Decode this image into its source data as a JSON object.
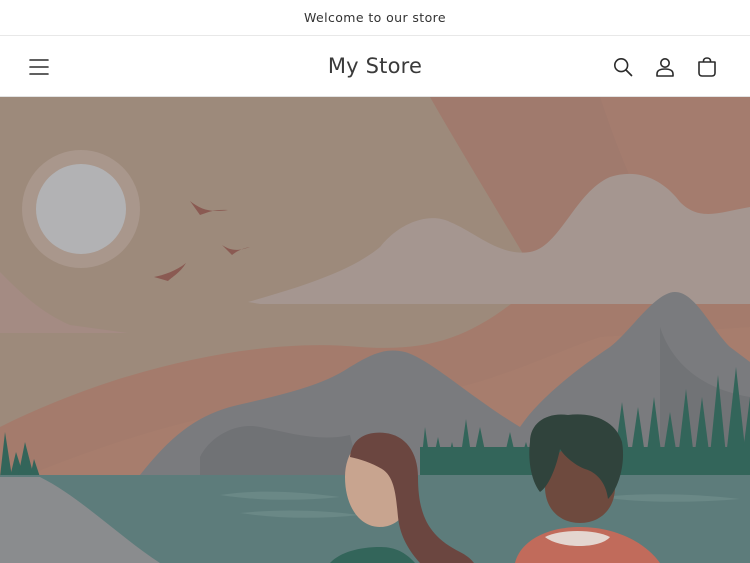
{
  "announcement": {
    "text": "Welcome to our store"
  },
  "header": {
    "store_name": "My Store",
    "icons": {
      "menu": "hamburger-menu-icon",
      "search": "search-icon",
      "account": "account-icon",
      "cart": "cart-icon"
    }
  },
  "hero": {
    "image": "landscape-illustration",
    "colors": {
      "sky": "#9e8878",
      "sun": "#b2b2b4",
      "cloud": "#a4968f",
      "mountain": "#787a7c",
      "trees": "#33655a",
      "water": "#5b7c7c"
    }
  }
}
